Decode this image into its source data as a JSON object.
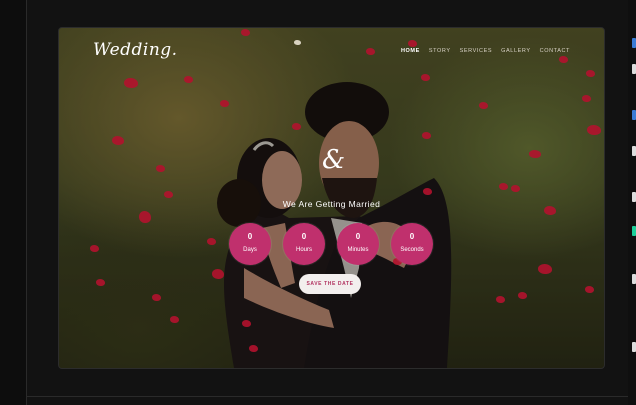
{
  "site": {
    "logo": "Wedding.",
    "nav": [
      "HOME",
      "STORY",
      "SERVICES",
      "GALLERY",
      "CONTACT"
    ],
    "active_nav": "HOME"
  },
  "hero": {
    "ampersand": "&",
    "headline": "We Are Getting Married",
    "countdown": [
      {
        "value": "0",
        "label": "Days"
      },
      {
        "value": "0",
        "label": "Hours"
      },
      {
        "value": "0",
        "label": "Minutes"
      },
      {
        "value": "0",
        "label": "Seconds"
      }
    ],
    "cta": "SAVE THE DATE"
  },
  "colors": {
    "accent": "#c0306d",
    "petal": "#b3122e",
    "button_bg": "#f3efee",
    "button_text": "#b23461"
  }
}
